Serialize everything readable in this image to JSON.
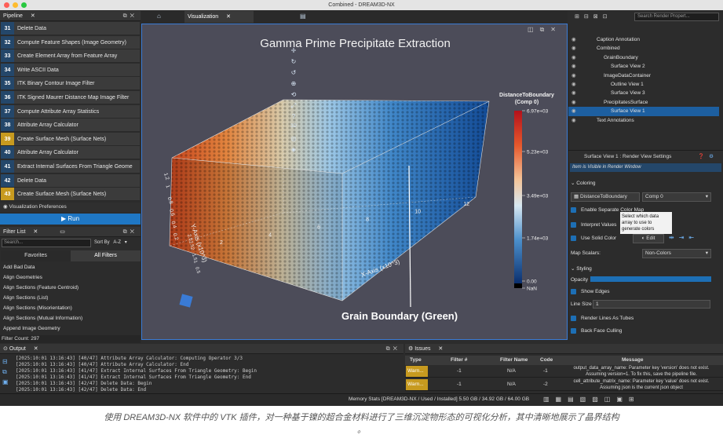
{
  "window": {
    "title": "Combined - DREAM3D-NX"
  },
  "pipeline": {
    "title": "Pipeline",
    "items": [
      {
        "num": "31",
        "label": "Delete Data",
        "warn": false
      },
      {
        "num": "32",
        "label": "Compute Feature Shapes (Image Geometry)",
        "warn": false
      },
      {
        "num": "33",
        "label": "Create Element Array from Feature Array",
        "warn": false
      },
      {
        "num": "34",
        "label": "Write ASCII Data",
        "warn": false
      },
      {
        "num": "35",
        "label": "ITK Binary Contour Image Filter",
        "warn": false
      },
      {
        "num": "36",
        "label": "ITK Signed Maurer Distance Map Image Filter",
        "warn": false
      },
      {
        "num": "37",
        "label": "Compute Attribute Array Statistics",
        "warn": false
      },
      {
        "num": "38",
        "label": "Attribute Array Calculator",
        "warn": false
      },
      {
        "num": "39",
        "label": "Create Surface Mesh (Surface Nets)",
        "warn": true
      },
      {
        "num": "40",
        "label": "Attribute Array Calculator",
        "warn": false
      },
      {
        "num": "41",
        "label": "Extract Internal Surfaces From Triangle Geome",
        "warn": false
      },
      {
        "num": "42",
        "label": "Delete Data",
        "warn": false
      },
      {
        "num": "43",
        "label": "Create Surface Mesh (Surface Nets)",
        "warn": true
      }
    ],
    "visualization_preferences": "Visualization Preferences",
    "run_label": "Run"
  },
  "filter_list": {
    "title": "Filter List",
    "search_placeholder": "Search...",
    "sort_label": "Sort By",
    "sort_value": "A-Z",
    "tab_favorites": "Favorites",
    "tab_all": "All Filters",
    "items": [
      "Add Bad Data",
      "Align Geometries",
      "Align Sections (Feature Centroid)",
      "Align Sections (List)",
      "Align Sections (Misorientation)",
      "Align Sections (Mutual Information)",
      "Append Image Geometry"
    ],
    "count": "Filter Count: 297"
  },
  "viz": {
    "tab_label": "Visualization",
    "title": "Gamma Prime Precipitate Extraction",
    "annotation": "Grain Boundary (Green)",
    "scalar_title": "DistanceToBoundary",
    "scalar_sub": "(Comp 0)",
    "scalar_ticks": [
      "6.97e+03",
      "5.23e+03",
      "3.49e+03",
      "1.74e+03",
      "0.00",
      "NaN"
    ],
    "x_axis": "X-Axis (x10^3)",
    "y_axis": "Y-Axis (x10^3)",
    "z_axis": "Z-Axis (x10^3)",
    "x_ticks": [
      "2",
      "4",
      "6",
      "8",
      "10",
      "12"
    ],
    "y_ticks": [
      "1.2",
      "1",
      "0.8",
      "0.6",
      "0.4",
      "0.2"
    ],
    "z_ticks": [
      "2.5",
      "2.5",
      "2",
      "1.5",
      "1",
      "0.5"
    ],
    "y_ticks_line": [
      "1.2",
      "1",
      "0.8",
      "0.6",
      "0.4",
      "0.2"
    ]
  },
  "render_tree": {
    "search_placeholder": "Search Render Propert...",
    "rows": [
      {
        "label": "Caption Annotation",
        "indent": 2,
        "selected": false
      },
      {
        "label": "Combined",
        "indent": 2,
        "selected": false
      },
      {
        "label": "GrainBoundary",
        "indent": 3,
        "selected": false
      },
      {
        "label": "Surface View 2",
        "indent": 4,
        "selected": false
      },
      {
        "label": "ImageDataContainer",
        "indent": 3,
        "selected": false
      },
      {
        "label": "Outline View 1",
        "indent": 4,
        "selected": false
      },
      {
        "label": "Surface View 3",
        "indent": 4,
        "selected": false
      },
      {
        "label": "PrecipitatesSurface",
        "indent": 3,
        "selected": false
      },
      {
        "label": "Surface View 1",
        "indent": 4,
        "selected": true
      },
      {
        "label": "Text Annotations",
        "indent": 2,
        "selected": false
      }
    ]
  },
  "settings": {
    "title": "Surface View 1 : Render View Settings",
    "visible_note": "Item is Visible in Render Window",
    "coloring": "Coloring",
    "array_value": "DistanceToBoundary",
    "comp_value": "Comp 0",
    "enable_separate": "Enable Separate Color Map",
    "tooltip": "Select which data array to use to generate colors",
    "interpret": "Interpret Values",
    "use_solid": "Use Solid Color",
    "edit": "Edit",
    "map_scalars_label": "Map Scalars:",
    "map_scalars_value": "Non-Colors",
    "styling": "Styling",
    "opacity": "Opacity",
    "opacity_value": 1.0,
    "show_edges": "Show Edges",
    "line_size_label": "Line Size",
    "line_size_value": "1",
    "render_lines": "Render Lines As Tubes",
    "back_face": "Back Face Culling"
  },
  "output": {
    "title": "Output",
    "lines": [
      "[2025:10:01 13:16:43] [40/47] Attribute Array Calculator: Computing Operator 3/3",
      "[2025:10:01 13:16:43] [40/47] Attribute Array Calculator: End",
      "[2025:10:01 13:16:43] [41/47] Extract Internal Surfaces From Triangle Geometry: Begin",
      "[2025:10:01 13:16:43] [41/47] Extract Internal Surfaces From Triangle Geometry: End",
      "[2025:10:01 13:16:43] [42/47] Delete Data: Begin",
      "[2025:10:01 13:16:43] [42/47] Delete Data: End"
    ]
  },
  "issues": {
    "title": "Issues",
    "columns": [
      "Type",
      "Filter #",
      "Filter Name",
      "Code",
      "Message"
    ],
    "rows": [
      {
        "type": "Warn...",
        "filter": "-1",
        "name": "N/A",
        "code": "-1",
        "msg1": "output_data_array_name: Parameter key 'version' does not exist.",
        "msg2": "Assuming version=1. To fix this, save the pipeline file."
      },
      {
        "type": "Warn...",
        "filter": "-1",
        "name": "N/A",
        "code": "-2",
        "msg1": "cell_attribute_matrix_name: Parameter key 'value' does not exist.",
        "msg2": "Assuming json is the current json object"
      }
    ]
  },
  "status": {
    "memory": "Memory Stats [DREAM3D-NX / Used / Installed] 5.50 GB / 34.92 GB / 64.00 GB"
  },
  "caption": {
    "line1": "使用 DREAM3D-NX 软件中的 VTK 插件，对一种基于镍的超合金材料进行了三维沉淀物形态的可视化分析，其中清晰地展示了晶界结构",
    "line2": "。"
  },
  "colors": {
    "accent": "#1d6fb5",
    "warn": "#c79a1f",
    "run": "#1f77c4"
  }
}
